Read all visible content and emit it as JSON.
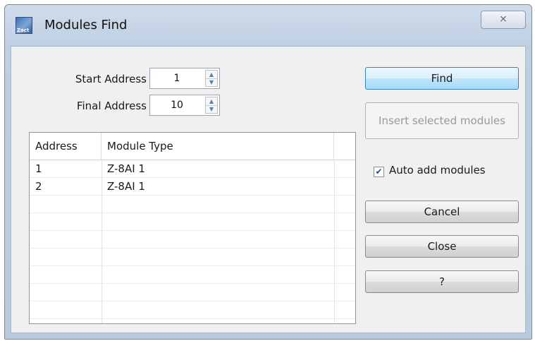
{
  "window": {
    "title": "Modules Find",
    "app_icon": "zact-app-icon",
    "app_icon_label": "Zact",
    "close_icon": "close-icon",
    "close_glyph": "⨯"
  },
  "form": {
    "start_label": "Start Address",
    "start_value": "1",
    "final_label": "Final Address",
    "final_value": "10"
  },
  "table": {
    "headers": [
      "Address",
      "Module Type"
    ],
    "rows": [
      [
        "1",
        "Z-8AI 1"
      ],
      [
        "2",
        "Z-8AI 1"
      ],
      [
        "",
        ""
      ],
      [
        "",
        ""
      ],
      [
        "",
        ""
      ],
      [
        "",
        ""
      ],
      [
        "",
        ""
      ],
      [
        "",
        ""
      ],
      [
        "",
        ""
      ],
      [
        "",
        ""
      ]
    ]
  },
  "buttons": {
    "find": "Find",
    "insert": "Insert selected modules",
    "auto_add": "Auto add modules",
    "auto_add_checked": true,
    "cancel": "Cancel",
    "close": "Close",
    "help": "?"
  },
  "colors": {
    "frame": "#bfcfe2",
    "client_bg": "#f0f0f0",
    "focus_button": "#bee6fd",
    "disabled_text": "#9a9a9a"
  }
}
